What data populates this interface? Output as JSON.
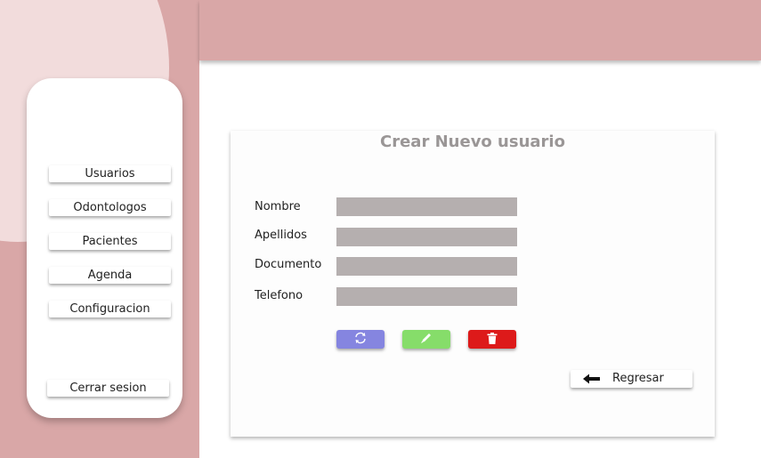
{
  "colors": {
    "sidebar_bg": "#d9a7a7",
    "sidebar_circle": "#f2dcdc",
    "input_bg": "#b5afaf",
    "title": "#9a9696",
    "refresh_btn": "#8585e0",
    "edit_btn": "#86dd6a",
    "delete_btn": "#dd1a1a"
  },
  "sidebar": {
    "items": [
      {
        "label": "Usuarios"
      },
      {
        "label": "Odontologos"
      },
      {
        "label": "Pacientes"
      },
      {
        "label": "Agenda"
      },
      {
        "label": "Configuracion"
      }
    ],
    "logout_label": "Cerrar sesion"
  },
  "form": {
    "title": "Crear Nuevo usuario",
    "fields": [
      {
        "label": "Nombre",
        "value": ""
      },
      {
        "label": "Apellidos",
        "value": ""
      },
      {
        "label": "Documento",
        "value": ""
      },
      {
        "label": "Telefono",
        "value": ""
      }
    ],
    "actions": [
      {
        "icon": "refresh-icon"
      },
      {
        "icon": "pencil-icon"
      },
      {
        "icon": "trash-icon"
      }
    ],
    "back_label": "Regresar",
    "back_icon": "arrow-left-icon"
  }
}
